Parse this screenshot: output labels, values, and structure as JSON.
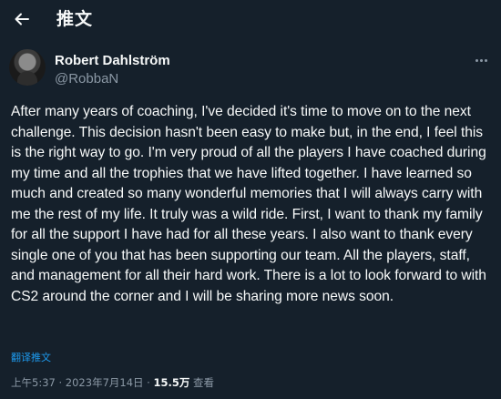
{
  "header": {
    "back_icon": "arrow-left-icon",
    "title": "推文"
  },
  "author": {
    "name": "Robert Dahlström",
    "handle": "@RobbaN",
    "more_icon": "more-horizontal-icon"
  },
  "tweet": {
    "text": "After many years of coaching, I've decided it's time to move on to the next challenge. This decision hasn't been easy to make but, in the end, I feel this is the right way to go. I'm very proud of all the players I have coached during my time and all the trophies that we have lifted together. I have learned so much and created so many wonderful memories that I will always carry with me the rest of my life. It truly was a wild ride. First, I want to thank my family for all the support I have had for all these years. I also want to thank every single one of you that has been supporting our team. All the players, staff, and management for all their hard work. There is a lot to look forward to with CS2 around the corner and I will be sharing more news soon.",
    "translate_label": "翻译推文"
  },
  "meta": {
    "time": "上午5:37",
    "separator": " · ",
    "date": "2023年7月14日",
    "views_count": "15.5万",
    "views_label": "查看"
  },
  "colors": {
    "background": "#15202b",
    "text": "#f7f9f9",
    "secondary": "#8b98a5",
    "accent": "#1d9bf0"
  }
}
